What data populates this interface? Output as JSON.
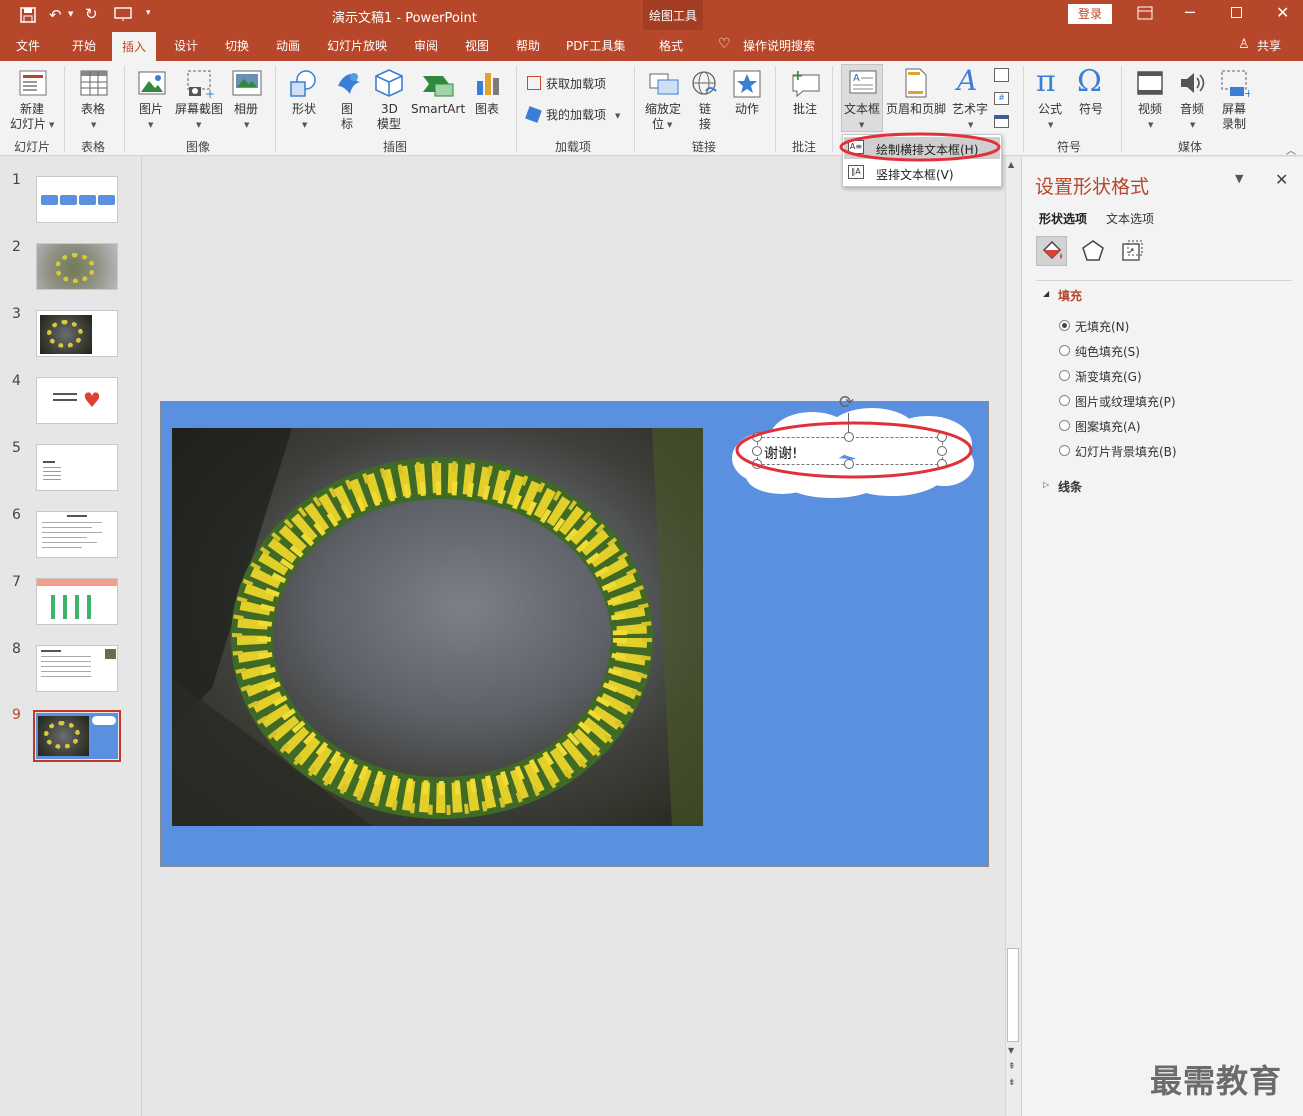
{
  "titlebar": {
    "title": "演示文稿1 - PowerPoint",
    "context_tab": "绘图工具",
    "login": "登录"
  },
  "tabs": [
    "文件",
    "开始",
    "插入",
    "设计",
    "切换",
    "动画",
    "幻灯片放映",
    "审阅",
    "视图",
    "帮助",
    "PDF工具集",
    "格式"
  ],
  "active_tab": "插入",
  "search_label": "操作说明搜索",
  "share_label": "共享",
  "ribbon": {
    "new_slide": "新建幻灯片",
    "new_slide_l1": "新建",
    "new_slide_l2": "幻灯片",
    "table": "表格",
    "picture": "图片",
    "screenshot": "屏幕截图",
    "album": "相册",
    "shapes": "形状",
    "icons_l1": "图",
    "icons_l2": "标",
    "model_l1": "3D",
    "model_l2": "模型",
    "smartart": "SmartArt",
    "chart": "图表",
    "get_addins": "获取加载项",
    "my_addins": "我的加载项",
    "zoom_l1": "缩放定",
    "zoom_l2": "位",
    "link_l1": "链",
    "link_l2": "接",
    "action": "动作",
    "comment": "批注",
    "textbox": "文本框",
    "header_footer": "页眉和页脚",
    "wordart": "艺术字",
    "equation": "公式",
    "symbol": "符号",
    "video": "视频",
    "audio": "音频",
    "record_l1": "屏幕",
    "record_l2": "录制"
  },
  "groups": {
    "slides": "幻灯片",
    "tables": "表格",
    "images": "图像",
    "illustrations": "插图",
    "addins": "加载项",
    "links": "链接",
    "comments": "批注",
    "symbols": "符号",
    "media": "媒体"
  },
  "dropdown": {
    "item1": "绘制横排文本框(H)",
    "item2": "竖排文本框(V)"
  },
  "slides": [
    "1",
    "2",
    "3",
    "4",
    "5",
    "6",
    "7",
    "8",
    "9"
  ],
  "selected_slide": "9",
  "slide": {
    "text": "谢谢!",
    "bg_color": "#5b8fe0"
  },
  "format_panel": {
    "title": "设置形状格式",
    "tab_shape": "形状选项",
    "tab_text": "文本选项",
    "fill_section": "填充",
    "fill_options": [
      "无填充(N)",
      "纯色填充(S)",
      "渐变填充(G)",
      "图片或纹理填充(P)",
      "图案填充(A)",
      "幻灯片背景填充(B)"
    ],
    "selected_fill": "无填充(N)",
    "line_section": "线条"
  },
  "watermark": "最需教育",
  "colors": {
    "accent": "#b7472a",
    "highlight": "#e0303a"
  }
}
